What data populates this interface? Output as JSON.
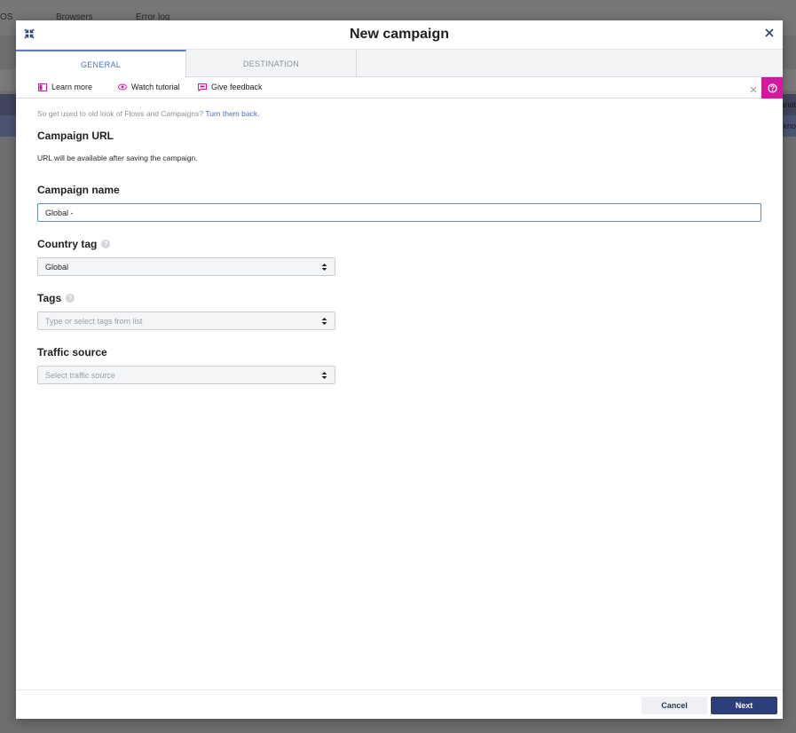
{
  "background": {
    "menu_os": "OS",
    "menu_browsers": "Browsers",
    "menu_error_log": "Error log",
    "right_text_1": "Variat",
    "right_text_2": "Unkno"
  },
  "modal": {
    "title": "New campaign",
    "tabs": [
      {
        "label": "GENERAL",
        "active": true
      },
      {
        "label": "DESTINATION",
        "active": false
      }
    ],
    "helpbar": {
      "learn_more": "Learn more",
      "watch_tutorial": "Watch tutorial",
      "give_feedback": "Give feedback"
    },
    "notice": {
      "text": "So get used to old look of Flows and Campaigns?",
      "link": "Turn them back."
    },
    "campaign_url": {
      "title": "Campaign URL",
      "note": "URL will be available after saving the campaign."
    },
    "campaign_name": {
      "title": "Campaign name",
      "value": "Global -"
    },
    "country_tag": {
      "title": "Country tag",
      "selected": "Global"
    },
    "tags": {
      "title": "Tags",
      "placeholder": "Type or select tags from list"
    },
    "traffic_source": {
      "title": "Traffic source",
      "placeholder": "Select traffic source"
    },
    "footer": {
      "cancel": "Cancel",
      "next": "Next"
    }
  },
  "colors": {
    "accent_blue": "#4a72b8",
    "help_magenta": "#d3189d",
    "primary_button": "#2d3f7a"
  },
  "icons": [
    "collapse-icon",
    "close-icon",
    "book-icon",
    "eye-icon",
    "feedback-icon",
    "help-close-icon",
    "question-icon",
    "info-icon",
    "select-arrows-icon"
  ]
}
